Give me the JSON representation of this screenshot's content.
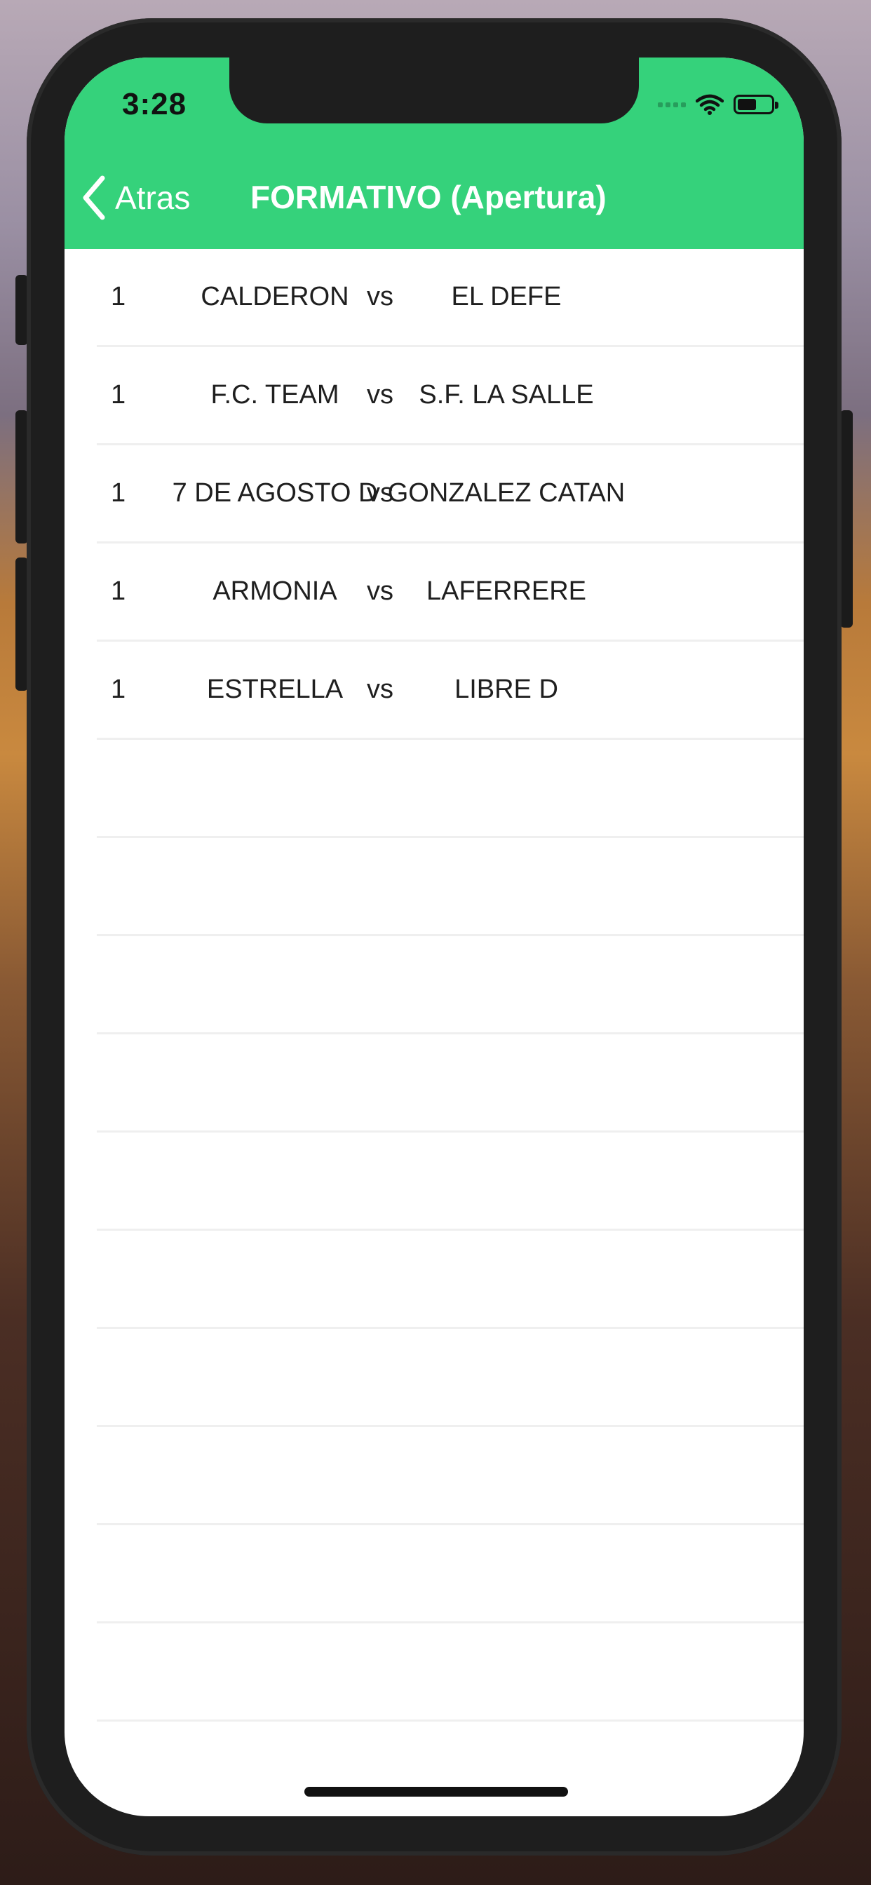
{
  "status_bar": {
    "time": "3:28"
  },
  "nav": {
    "back_label": "Atras",
    "title": "FORMATIVO (Apertura)"
  },
  "theme": {
    "accent": "#35d27b"
  },
  "matches": [
    {
      "round": "1",
      "home": "CALDERON",
      "vs": "vs",
      "away": "EL DEFE"
    },
    {
      "round": "1",
      "home": "F.C. TEAM",
      "vs": "vs",
      "away": "S.F. LA SALLE"
    },
    {
      "round": "1",
      "home": "7 DE AGOSTO D",
      "vs": "vs",
      "away": "GONZALEZ CATAN"
    },
    {
      "round": "1",
      "home": "ARMONIA",
      "vs": "vs",
      "away": "LAFERRERE"
    },
    {
      "round": "1",
      "home": "ESTRELLA",
      "vs": "vs",
      "away": "LIBRE D"
    }
  ],
  "icons": {
    "back": "chevron-left-icon",
    "wifi": "wifi-icon",
    "battery": "battery-icon"
  }
}
